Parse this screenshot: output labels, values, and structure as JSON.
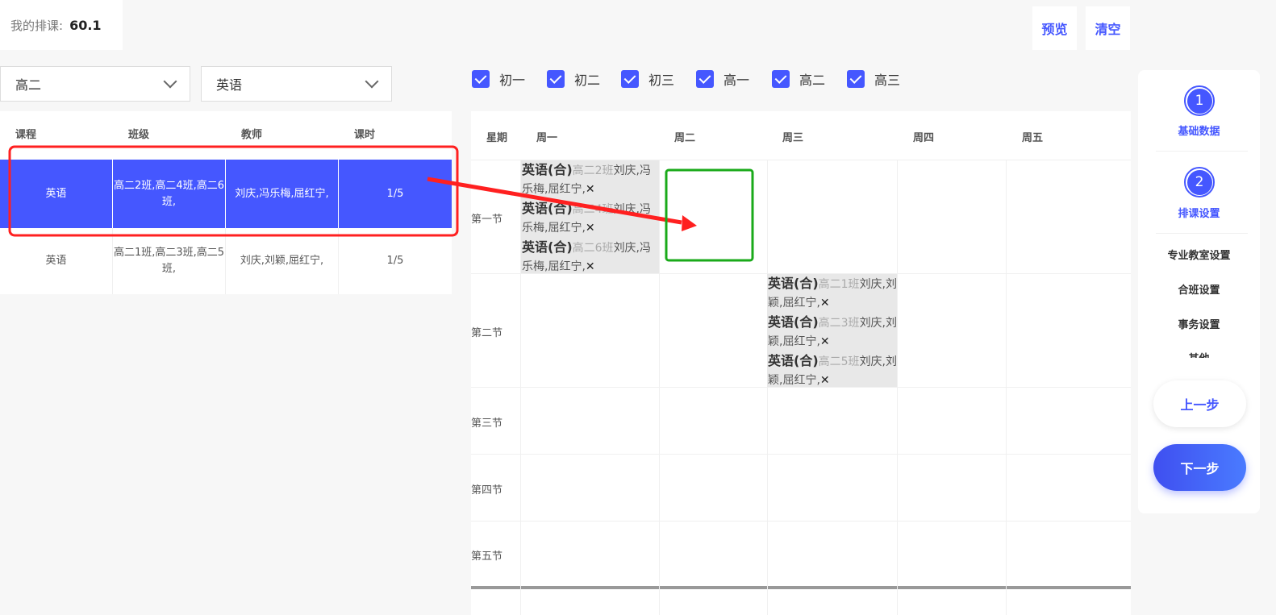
{
  "header": {
    "score_label": "我的排课:",
    "score_value": "60.1",
    "preview": "预览",
    "clear": "清空"
  },
  "filters": {
    "grade": "高二",
    "subject": "英语"
  },
  "grades": [
    "初一",
    "初二",
    "初三",
    "高一",
    "高二",
    "高三"
  ],
  "course_table": {
    "headers": [
      "课程",
      "班级",
      "教师",
      "课时"
    ],
    "rows": [
      [
        "英语",
        "高二2班,高二4班,高二6班,",
        "刘庆,冯乐梅,屈红宁,",
        "1/5"
      ],
      [
        "英语",
        "高二1班,高二3班,高二5班,",
        "刘庆,刘颖,屈红宁,",
        "1/5"
      ]
    ]
  },
  "timetable": {
    "headers": [
      "星期",
      "周一",
      "周二",
      "周三",
      "周四",
      "周五"
    ],
    "periods": [
      "第一节",
      "第二节",
      "第三节",
      "第四节",
      "第五节"
    ],
    "mon1": [
      {
        "c": "英语(合)",
        "k": "高二2班",
        "t": "刘庆,冯乐梅,屈红宁,"
      },
      {
        "c": "英语(合)",
        "k": "高二4班",
        "t": "刘庆,冯乐梅,屈红宁,"
      },
      {
        "c": "英语(合)",
        "k": "高二6班",
        "t": "刘庆,冯乐梅,屈红宁,"
      }
    ],
    "wed2": [
      {
        "c": "英语(合)",
        "k": "高二1班",
        "t": "刘庆,刘颖,屈红宁,"
      },
      {
        "c": "英语(合)",
        "k": "高二3班",
        "t": "刘庆,刘颖,屈红宁,"
      },
      {
        "c": "英语(合)",
        "k": "高二5班",
        "t": "刘庆,刘颖,屈红宁,"
      }
    ],
    "remove": "✕"
  },
  "steps": {
    "s1_num": "1",
    "s1": "基础数据",
    "s2_num": "2",
    "s2": "排课设置",
    "subs": [
      "专业教室设置",
      "合班设置",
      "事务设置",
      "其他"
    ],
    "prev": "上一步",
    "next": "下一步"
  },
  "colors": {
    "accent": "#4557ff",
    "annotation_red": "#ff2020",
    "annotation_green": "#1aaa1a"
  }
}
